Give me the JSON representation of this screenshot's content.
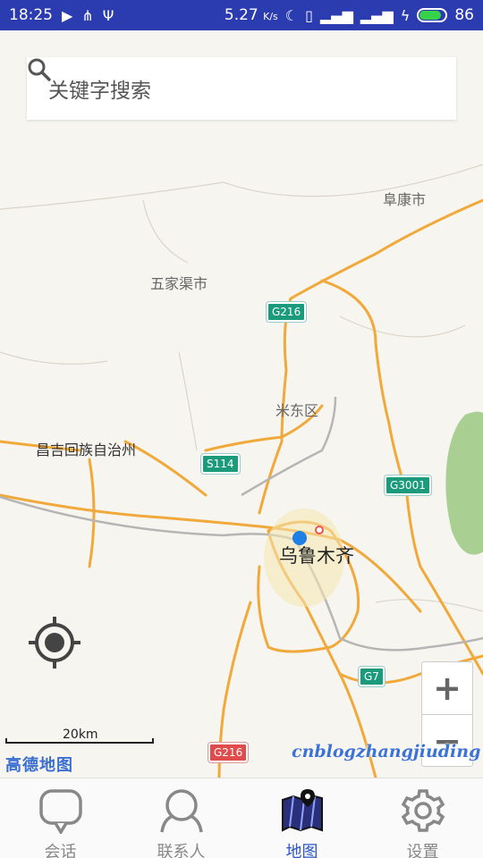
{
  "status_bar": {
    "time": "18:25",
    "network_speed": "5.27",
    "speed_unit": "K/s",
    "battery": "86",
    "battery_color": "#35d24a"
  },
  "search": {
    "placeholder": "关键字搜索"
  },
  "map": {
    "places": {
      "fukang": "阜康市",
      "wujiaqu": "五家渠市",
      "midong": "米东区",
      "changji": "昌吉回族自治州",
      "urumqi": "乌鲁木齐"
    },
    "roads": {
      "g216_top": "G216",
      "s114": "S114",
      "g3001": "G3001",
      "g7": "G7",
      "g216_bottom": "G216"
    },
    "scale_label": "20km",
    "logo": "高德地图",
    "watermark": "cnblogzhangjiuding",
    "zoom_in": "+",
    "zoom_out": "−"
  },
  "tabs": [
    {
      "label": "会话",
      "icon": "chat-bubble-icon"
    },
    {
      "label": "联系人",
      "icon": "person-icon"
    },
    {
      "label": "地图",
      "icon": "map-icon",
      "active": true
    },
    {
      "label": "设置",
      "icon": "gear-icon"
    }
  ],
  "colors": {
    "status_bar": "#2b3bb0",
    "active_tab": "#2e55c5",
    "road": "#f0a93a",
    "highway_shield": "#1b9b7c"
  }
}
